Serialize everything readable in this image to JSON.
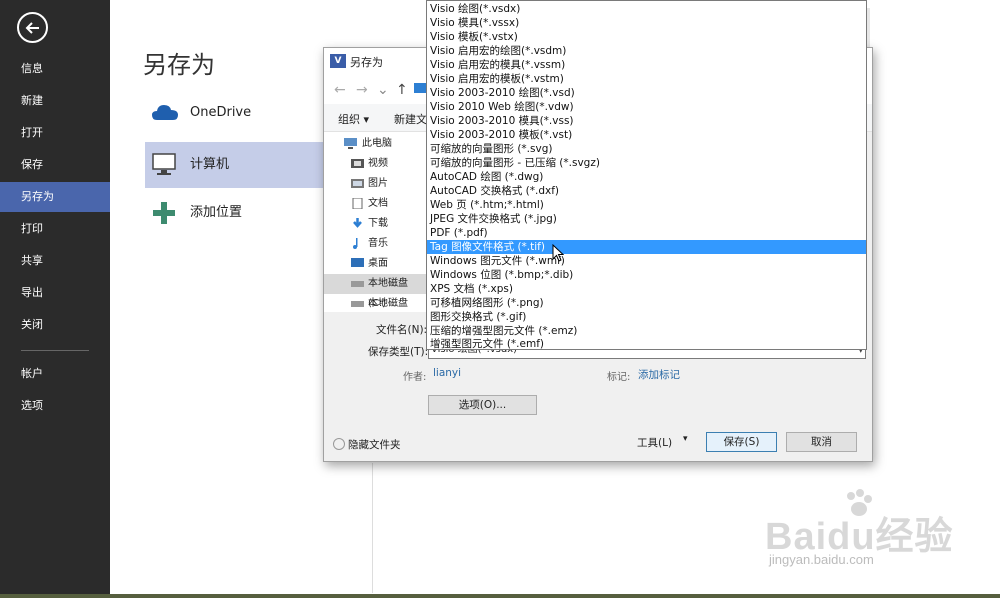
{
  "nav": {
    "items": [
      {
        "label": "信息"
      },
      {
        "label": "新建"
      },
      {
        "label": "打开"
      },
      {
        "label": "保存"
      },
      {
        "label": "另存为"
      },
      {
        "label": "打印"
      },
      {
        "label": "共享"
      },
      {
        "label": "导出"
      },
      {
        "label": "关闭"
      },
      {
        "label": "帐户"
      },
      {
        "label": "选项"
      }
    ],
    "active_label": "另存为"
  },
  "main": {
    "title": "另存为",
    "places": [
      {
        "label": "OneDrive",
        "icon": "cloud-icon"
      },
      {
        "label": "计算机",
        "icon": "computer-icon"
      },
      {
        "label": "添加位置",
        "icon": "plus-icon"
      }
    ]
  },
  "dialog": {
    "title": "另存为",
    "toolbar": {
      "organize": "组织 ▾",
      "new_folder": "新建文"
    },
    "tree": [
      {
        "label": "此电脑",
        "icon": "pc-icon"
      },
      {
        "label": "视频",
        "icon": "video-icon"
      },
      {
        "label": "图片",
        "icon": "picture-icon"
      },
      {
        "label": "文档",
        "icon": "document-icon"
      },
      {
        "label": "下载",
        "icon": "download-icon"
      },
      {
        "label": "音乐",
        "icon": "music-icon"
      },
      {
        "label": "桌面",
        "icon": "desktop-icon"
      },
      {
        "label": "本地磁盘 (C:)",
        "icon": "disk-icon"
      },
      {
        "label": "本地磁盘 (D:)",
        "icon": "disk-icon"
      }
    ],
    "filename_label": "文件名(N):",
    "filetype_label": "保存类型(T):",
    "filetype_value": "Visio 绘图(*.vsdx)",
    "author_label": "作者:",
    "author_value": "lianyi",
    "tags_label": "标记:",
    "tags_value": "添加标记",
    "options_button": "选项(O)...",
    "hide_folders": "隐藏文件夹",
    "tools_button": "工具(L)",
    "save_button": "保存(S)",
    "cancel_button": "取消"
  },
  "dropdown": {
    "options": [
      "Visio 绘图(*.vsdx)",
      "Visio 模具(*.vssx)",
      "Visio 模板(*.vstx)",
      "Visio 启用宏的绘图(*.vsdm)",
      "Visio 启用宏的模具(*.vssm)",
      "Visio 启用宏的模板(*.vstm)",
      "Visio 2003-2010 绘图(*.vsd)",
      "Visio 2010 Web 绘图(*.vdw)",
      "Visio 2003-2010 模具(*.vss)",
      "Visio 2003-2010 模板(*.vst)",
      "可缩放的向量图形 (*.svg)",
      "可缩放的向量图形 - 已压缩 (*.svgz)",
      "AutoCAD 绘图 (*.dwg)",
      "AutoCAD 交换格式 (*.dxf)",
      "Web 页 (*.htm;*.html)",
      "JPEG 文件交换格式 (*.jpg)",
      "PDF (*.pdf)",
      "Tag 图像文件格式 (*.tif)",
      "Windows 图元文件 (*.wmf)",
      "Windows 位图 (*.bmp;*.dib)",
      "XPS 文档 (*.xps)",
      "可移植网络图形 (*.png)",
      "图形交换格式 (*.gif)",
      "压缩的增强型图元文件 (*.emz)",
      "增强型图元文件 (*.emf)"
    ],
    "highlighted": "Tag 图像文件格式 (*.tif)"
  },
  "watermark": {
    "text": "Baidu经验",
    "url": "jingyan.baidu.com"
  },
  "colors": {
    "nav_bg": "#2b2b2b",
    "nav_active": "#4a66ac",
    "place_active": "#c5cde8",
    "highlight": "#3399ff",
    "link": "#2b6aa6"
  }
}
